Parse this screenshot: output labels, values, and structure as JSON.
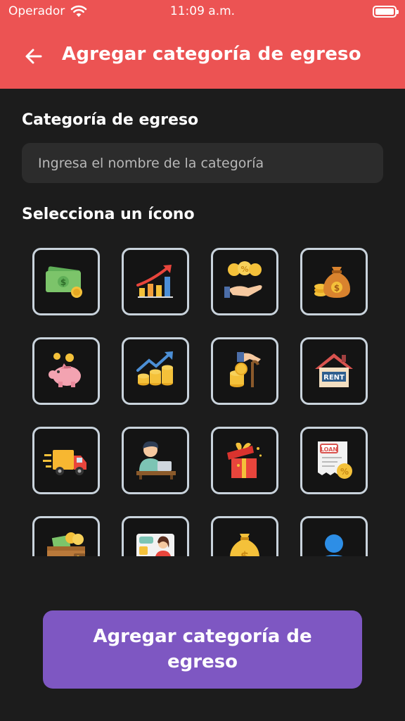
{
  "status_bar": {
    "carrier": "Operador",
    "time": "11:09 a.m."
  },
  "app_bar": {
    "title": "Agregar categoría de egreso",
    "back_icon": "arrow-left-icon"
  },
  "form": {
    "name_label": "Categoría de egreso",
    "name_placeholder": "Ingresa el nombre de la categoría",
    "name_value": "",
    "icon_label": "Selecciona un ícono"
  },
  "icons": [
    "money-bills-icon",
    "growth-chart-icon",
    "coins-hand-icon",
    "money-bag-icon",
    "piggy-bank-icon",
    "investment-coins-icon",
    "pension-icon",
    "rent-house-icon",
    "delivery-truck-icon",
    "remote-worker-icon",
    "gift-box-icon",
    "loan-document-icon",
    "wallet-icon",
    "video-call-icon",
    "dollar-sack-icon",
    "user-avatar-icon"
  ],
  "submit": {
    "label": "Agregar categoría de egreso"
  },
  "colors": {
    "header": "#ec5353",
    "background": "#1c1c1c",
    "input": "#2c2c2c",
    "button": "#7e57c2",
    "tile_border": "#c9d3dc"
  }
}
